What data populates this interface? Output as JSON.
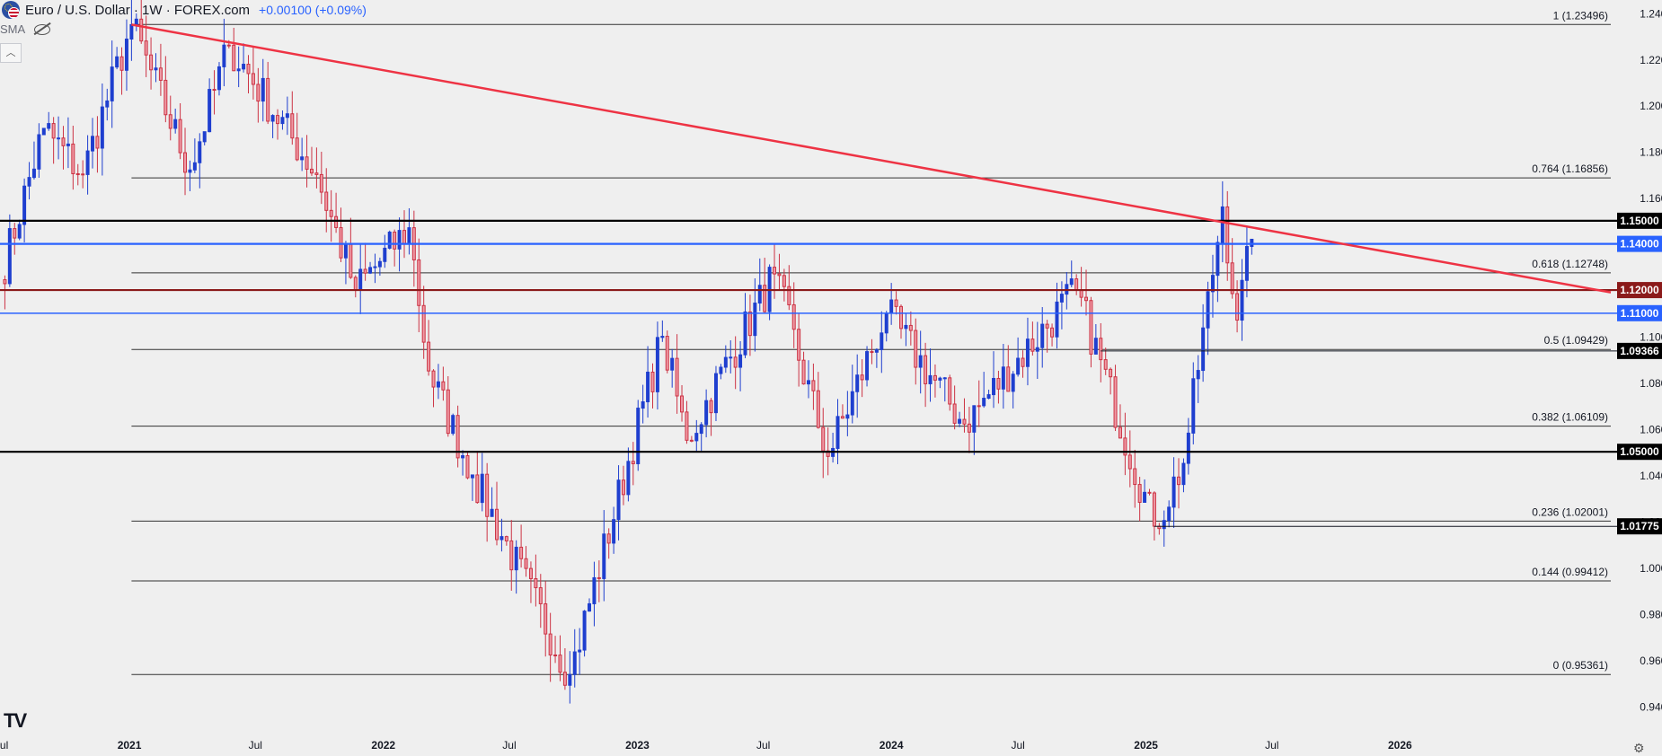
{
  "header": {
    "symbol_title": "Euro / U.S. Dollar · 1W · FOREX.com",
    "change": "+0.00100 (+0.09%)",
    "indicator": "SMA",
    "collapse_icon": "chevron-up-icon"
  },
  "logo_text": "TV",
  "colors": {
    "background": "#efefef",
    "up_candle": "#1f3fcf",
    "down_candle": "#cc3344",
    "trendline": "#ee3344",
    "fib_line": "#333333",
    "level_black": "#000000",
    "level_blue": "#2962ff",
    "level_maroon": "#8b1a1a"
  },
  "chart_data": {
    "type": "candlestick",
    "symbol": "EURUSD",
    "timeframe": "1W",
    "ylim": [
      0.93,
      1.244
    ],
    "x_range": [
      "2020-06-29",
      "2026-10-31"
    ],
    "y_ticks": [
      "1.24000",
      "1.22000",
      "1.20000",
      "1.18000",
      "1.16000",
      "1.14000",
      "1.12000",
      "1.10000",
      "1.08000",
      "1.06000",
      "1.04000",
      "1.02000",
      "1.00000",
      "0.98000",
      "0.96000",
      "0.94000"
    ],
    "x_ticks": [
      {
        "date": "2020-07-01",
        "label": "Jul"
      },
      {
        "date": "2021-01-01",
        "label": "2021"
      },
      {
        "date": "2021-07-01",
        "label": "Jul"
      },
      {
        "date": "2022-01-01",
        "label": "2022"
      },
      {
        "date": "2022-07-01",
        "label": "Jul"
      },
      {
        "date": "2023-01-01",
        "label": "2023"
      },
      {
        "date": "2023-07-01",
        "label": "Jul"
      },
      {
        "date": "2024-01-01",
        "label": "2024"
      },
      {
        "date": "2024-07-01",
        "label": "Jul"
      },
      {
        "date": "2025-01-01",
        "label": "2025"
      },
      {
        "date": "2025-07-01",
        "label": "Jul"
      },
      {
        "date": "2026-01-01",
        "label": "2026"
      }
    ],
    "series_start": "2020-06-29",
    "anchors": [
      {
        "date": "2020-06-29",
        "price": 1.1245
      },
      {
        "date": "2020-08-31",
        "price": 1.19
      },
      {
        "date": "2020-10-26",
        "price": 1.17
      },
      {
        "date": "2021-01-04",
        "price": 1.2349
      },
      {
        "date": "2021-03-29",
        "price": 1.172
      },
      {
        "date": "2021-05-24",
        "price": 1.226
      },
      {
        "date": "2021-09-27",
        "price": 1.17
      },
      {
        "date": "2021-11-22",
        "price": 1.12
      },
      {
        "date": "2022-02-07",
        "price": 1.147
      },
      {
        "date": "2022-03-07",
        "price": 1.085
      },
      {
        "date": "2022-05-09",
        "price": 1.04
      },
      {
        "date": "2022-09-26",
        "price": 0.9536
      },
      {
        "date": "2023-02-06",
        "price": 1.1
      },
      {
        "date": "2023-03-13",
        "price": 1.055
      },
      {
        "date": "2023-07-17",
        "price": 1.127
      },
      {
        "date": "2023-10-02",
        "price": 1.048
      },
      {
        "date": "2023-12-25",
        "price": 1.11
      },
      {
        "date": "2024-04-15",
        "price": 1.062
      },
      {
        "date": "2024-09-23",
        "price": 1.12
      },
      {
        "date": "2025-01-13",
        "price": 1.0178
      },
      {
        "date": "2025-02-24",
        "price": 1.045
      },
      {
        "date": "2025-04-21",
        "price": 1.156
      },
      {
        "date": "2025-05-12",
        "price": 1.107
      },
      {
        "date": "2025-06-02",
        "price": 1.142
      }
    ],
    "last_close": 1.142,
    "horizontal_levels": [
      {
        "price": 1.15,
        "label": "1.15000",
        "style": "black"
      },
      {
        "price": 1.14,
        "label": "1.14000",
        "style": "blue"
      },
      {
        "price": 1.12,
        "label": "1.12000",
        "style": "maroon"
      },
      {
        "price": 1.11,
        "label": "1.11000",
        "style": "blue"
      },
      {
        "price": 1.05,
        "label": "1.05000",
        "style": "black"
      }
    ],
    "price_markers": [
      {
        "price": 1.09366,
        "label": "1.09366",
        "from": "2024-10-28"
      },
      {
        "price": 1.01775,
        "label": "1.01775",
        "from": "2025-01-13"
      }
    ],
    "fibonacci": {
      "from_date": "2021-01-04",
      "levels": [
        {
          "ratio": "1",
          "price": 1.23496,
          "label": "1 (1.23496)"
        },
        {
          "ratio": "0.764",
          "price": 1.16856,
          "label": "0.764 (1.16856)"
        },
        {
          "ratio": "0.618",
          "price": 1.12748,
          "label": "0.618 (1.12748)"
        },
        {
          "ratio": "0.5",
          "price": 1.09429,
          "label": "0.5 (1.09429)"
        },
        {
          "ratio": "0.382",
          "price": 1.06109,
          "label": "0.382 (1.06109)"
        },
        {
          "ratio": "0.236",
          "price": 1.02001,
          "label": "0.236 (1.02001)"
        },
        {
          "ratio": "0.144",
          "price": 0.99412,
          "label": "0.144 (0.99412)"
        },
        {
          "ratio": "0",
          "price": 0.95361,
          "label": "0 (0.95361)"
        }
      ]
    },
    "trendline": {
      "start": {
        "date": "2021-01-04",
        "price": 1.2349
      },
      "end": {
        "date": "2026-10-31",
        "price": 1.119
      }
    },
    "grid": false
  }
}
